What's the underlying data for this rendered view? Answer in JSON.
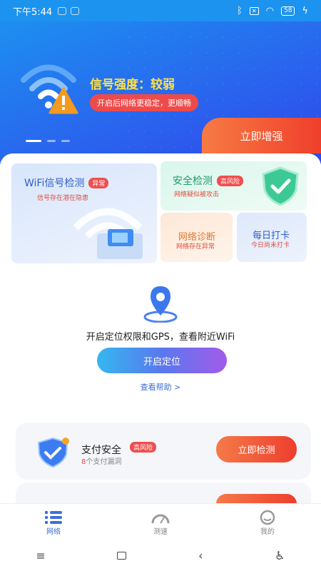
{
  "status_bar": {
    "time": "下午5:44",
    "battery": "58"
  },
  "hero": {
    "title": "信号强度：较弱",
    "subtitle": "开启后网络更稳定，更顺畅",
    "boost_button": "立即增强"
  },
  "cards": {
    "wifi": {
      "title": "WiFi信号检测",
      "tag": "异常",
      "desc": "信号存在潜在隐患"
    },
    "security": {
      "title": "安全检测",
      "tag": "高风险",
      "desc": "网络疑似被攻击"
    },
    "diagnosis": {
      "title": "网络诊断",
      "desc": "网络存在异常"
    },
    "checkin": {
      "title": "每日打卡",
      "desc": "今日尚未打卡"
    }
  },
  "location": {
    "text": "开启定位权限和GPS，查看附近WiFi",
    "button": "开启定位",
    "help": "查看帮助 >"
  },
  "payment": {
    "title": "支付安全",
    "tag": "高风险",
    "count": "8",
    "desc_suffix": "个支付漏洞",
    "button": "立即检测"
  },
  "tabs": [
    {
      "label": "网络"
    },
    {
      "label": "测速"
    },
    {
      "label": "我的"
    }
  ],
  "colors": {
    "accent": "#3d6fd6",
    "danger": "#ef4e4e",
    "hero_blue": "#2a63ee"
  }
}
